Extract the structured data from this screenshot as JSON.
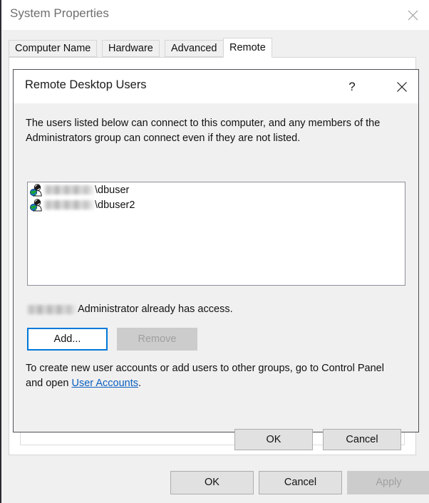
{
  "window": {
    "title": "System Properties",
    "close_icon": "close-icon"
  },
  "tabs": [
    {
      "label": "Computer Name",
      "active": false
    },
    {
      "label": "Hardware",
      "active": false
    },
    {
      "label": "Advanced",
      "active": false
    },
    {
      "label": "Remote",
      "active": true
    }
  ],
  "footer": {
    "ok_label": "OK",
    "cancel_label": "Cancel",
    "apply_label": "Apply",
    "apply_disabled": true
  },
  "dialog": {
    "title": "Remote Desktop Users",
    "help_label": "?",
    "close_icon": "close-icon",
    "description": "The users listed below can connect to this computer, and any members of the Administrators group can connect even if they are not listed.",
    "users": [
      {
        "domain_redacted": true,
        "name": "\\dbuser",
        "icon": "user-globe-icon"
      },
      {
        "domain_redacted": true,
        "name": "\\dbuser2",
        "icon": "user-globe-icon"
      }
    ],
    "admin_notice": "Administrator already has access.",
    "admin_domain_redacted": true,
    "add_label": "Add...",
    "add_focused": true,
    "remove_label": "Remove",
    "remove_disabled": true,
    "create_accounts_text_before": "To create new user accounts or add users to other groups, go to Control Panel and open ",
    "create_accounts_link": "User Accounts",
    "create_accounts_text_after": ".",
    "ok_label": "OK",
    "cancel_label": "Cancel"
  },
  "colors": {
    "accent": "#0078d7",
    "link": "#0b5fbf",
    "window_bg": "#f0f0f0",
    "panel_bg": "#ffffff",
    "button_bg": "#e1e1e1",
    "disabled_text": "#a0a0a0"
  }
}
